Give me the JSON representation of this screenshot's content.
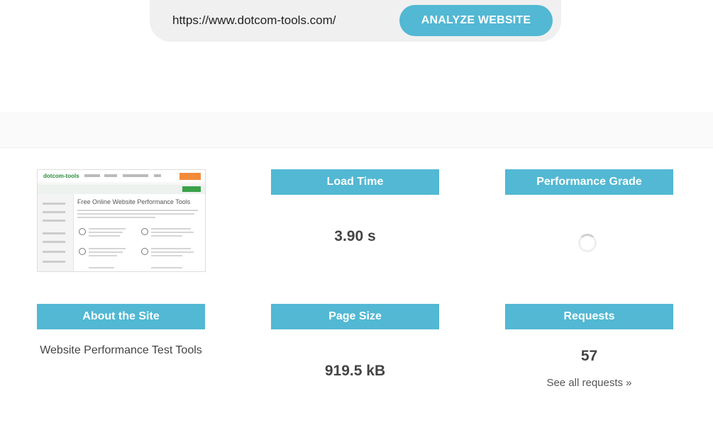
{
  "analyze": {
    "url_value": "https://www.dotcom-tools.com/",
    "button_label": "ANALYZE WEBSITE"
  },
  "cards": {
    "load_time": {
      "label": "Load Time",
      "value": "3.90 s"
    },
    "performance_grade": {
      "label": "Performance Grade"
    },
    "about": {
      "label": "About the Site",
      "text": "Website Performance Test Tools"
    },
    "page_size": {
      "label": "Page Size",
      "value": "919.5 kB"
    },
    "requests": {
      "label": "Requests",
      "value": "57",
      "link": "See all requests »"
    }
  },
  "thumbnail": {
    "logo": "dotcom-tools",
    "heading": "Free Online Website Performance Tools"
  },
  "colors": {
    "accent": "#52b8d3",
    "bar_bg": "#f0f0f0"
  }
}
